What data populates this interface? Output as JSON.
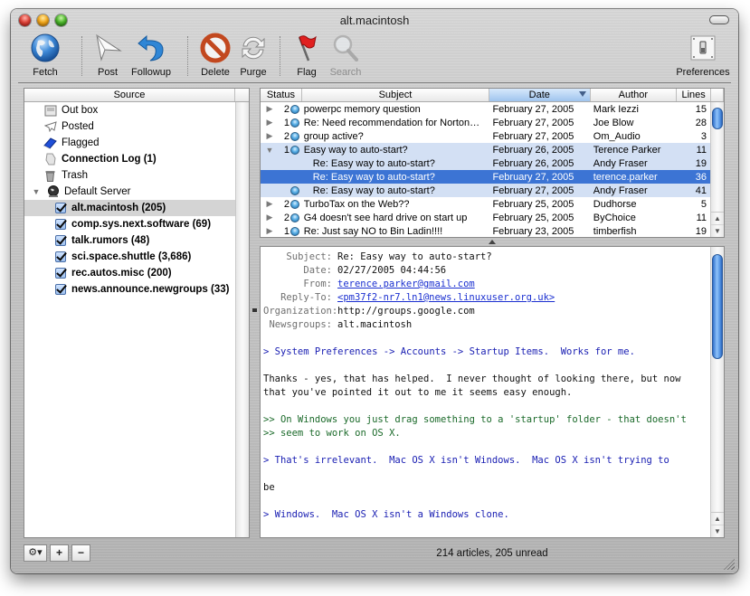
{
  "window": {
    "title": "alt.macintosh",
    "controls": [
      "close",
      "minimize",
      "zoom"
    ]
  },
  "toolbar": {
    "items": [
      {
        "id": "fetch",
        "label": "Fetch",
        "icon": "globe-icon",
        "enabled": true
      },
      {
        "id": "post",
        "label": "Post",
        "icon": "paper-plane-icon",
        "enabled": true
      },
      {
        "id": "followup",
        "label": "Followup",
        "icon": "reply-arrow-icon",
        "enabled": true
      },
      {
        "id": "delete",
        "label": "Delete",
        "icon": "no-entry-icon",
        "enabled": true
      },
      {
        "id": "purge",
        "label": "Purge",
        "icon": "refresh-arrows-icon",
        "enabled": true
      },
      {
        "id": "flag",
        "label": "Flag",
        "icon": "red-flag-icon",
        "enabled": true
      },
      {
        "id": "search",
        "label": "Search",
        "icon": "magnifier-icon",
        "enabled": false
      },
      {
        "id": "preferences",
        "label": "Preferences",
        "icon": "light-switch-icon",
        "enabled": true
      }
    ]
  },
  "source": {
    "header": "Source",
    "items": [
      {
        "label": "Out box",
        "icon": "outbox-icon",
        "bold": false,
        "level": 1
      },
      {
        "label": "Posted",
        "icon": "paper-plane-icon",
        "bold": false,
        "level": 1
      },
      {
        "label": "Flagged",
        "icon": "blue-book-icon",
        "bold": false,
        "level": 1
      },
      {
        "label": "Connection Log (1)",
        "icon": "log-document-icon",
        "bold": true,
        "level": 1
      },
      {
        "label": "Trash",
        "icon": "trash-icon",
        "bold": false,
        "level": 1
      },
      {
        "label": "Default Server",
        "icon": "server-globe-icon",
        "bold": false,
        "level": 0,
        "expanded": true
      }
    ],
    "groups": [
      {
        "label": "alt.macintosh (205)",
        "checked": true,
        "selected": true
      },
      {
        "label": "comp.sys.next.software (69)",
        "checked": true,
        "selected": false
      },
      {
        "label": "talk.rumors (48)",
        "checked": true,
        "selected": false
      },
      {
        "label": "sci.space.shuttle (3,686)",
        "checked": true,
        "selected": false
      },
      {
        "label": "rec.autos.misc (200)",
        "checked": true,
        "selected": false
      },
      {
        "label": "news.announce.newgroups (33)",
        "checked": true,
        "selected": false
      }
    ]
  },
  "articles": {
    "columns": [
      "Status",
      "Subject",
      "Date",
      "Author",
      "Lines"
    ],
    "sorted_column": "Date",
    "rows": [
      {
        "disclosure": "collapsed",
        "count": "2",
        "unread": true,
        "subject": "powerpc memory question",
        "date": "February 27, 2005",
        "author": "Mark Iezzi",
        "lines": "15",
        "state": "normal",
        "reply": false
      },
      {
        "disclosure": "collapsed",
        "count": "1",
        "unread": true,
        "subject": "Re: Need recommendation for Norton…",
        "date": "February 27, 2005",
        "author": "Joe Blow",
        "lines": "28",
        "state": "normal",
        "reply": false
      },
      {
        "disclosure": "collapsed",
        "count": "2",
        "unread": true,
        "subject": "group active?",
        "date": "February 27, 2005",
        "author": "Om_Audio",
        "lines": "3",
        "state": "normal",
        "reply": false
      },
      {
        "disclosure": "expanded",
        "count": "1",
        "unread": true,
        "subject": "Easy way to auto-start?",
        "date": "February 26, 2005",
        "author": "Terence Parker",
        "lines": "11",
        "state": "thread",
        "reply": false
      },
      {
        "disclosure": "",
        "count": "",
        "unread": false,
        "subject": "Re: Easy way to auto-start?",
        "date": "February 26, 2005",
        "author": "Andy Fraser",
        "lines": "19",
        "state": "thread",
        "reply": true
      },
      {
        "disclosure": "",
        "count": "",
        "unread": false,
        "subject": "Re: Easy way to auto-start?",
        "date": "February 27, 2005",
        "author": "terence.parker",
        "lines": "36",
        "state": "selected",
        "reply": true
      },
      {
        "disclosure": "",
        "count": "",
        "unread": true,
        "subject": "Re: Easy way to auto-start?",
        "date": "February 27, 2005",
        "author": "Andy Fraser",
        "lines": "41",
        "state": "thread",
        "reply": true
      },
      {
        "disclosure": "collapsed",
        "count": "2",
        "unread": true,
        "subject": "TurboTax on the Web??",
        "date": "February 25, 2005",
        "author": "Dudhorse",
        "lines": "5",
        "state": "normal",
        "reply": false
      },
      {
        "disclosure": "collapsed",
        "count": "2",
        "unread": true,
        "subject": "G4 doesn't see hard drive on start up",
        "date": "February 25, 2005",
        "author": "ByChoice",
        "lines": "11",
        "state": "normal",
        "reply": false
      },
      {
        "disclosure": "collapsed",
        "count": "1",
        "unread": true,
        "subject": "Re: Just say NO to Bin Ladin!!!!",
        "date": "February 23, 2005",
        "author": "timberfish",
        "lines": "19",
        "state": "normal",
        "reply": false
      }
    ]
  },
  "message": {
    "headers": [
      {
        "key": "Subject:",
        "value": "Re: Easy way to auto-start?",
        "link": false
      },
      {
        "key": "Date:",
        "value": "02/27/2005 04:44:56",
        "link": false
      },
      {
        "key": "From:",
        "value": "terence.parker@gmail.com",
        "link": true
      },
      {
        "key": "Reply-To:",
        "value": "<pm37f2-nr7.ln1@news.linuxuser.org.uk>",
        "link": true
      },
      {
        "key": "Organization:",
        "value": "http://groups.google.com",
        "link": false
      },
      {
        "key": "Newsgroups:",
        "value": "alt.macintosh",
        "link": false
      }
    ],
    "body": [
      {
        "text": "",
        "style": "gap"
      },
      {
        "text": "> System Preferences -> Accounts -> Startup Items.  Works for me.",
        "style": "q1"
      },
      {
        "text": "",
        "style": "gap"
      },
      {
        "text": "Thanks - yes, that has helped.  I never thought of looking there, but now",
        "style": "plain"
      },
      {
        "text": "that you've pointed it out to me it seems easy enough.",
        "style": "plain"
      },
      {
        "text": "",
        "style": "gap"
      },
      {
        "text": ">> On Windows you just drag something to a 'startup' folder - that doesn't",
        "style": "q2"
      },
      {
        "text": ">> seem to work on OS X.",
        "style": "q2"
      },
      {
        "text": "",
        "style": "gap"
      },
      {
        "text": "> That's irrelevant.  Mac OS X isn't Windows.  Mac OS X isn't trying to",
        "style": "q1"
      },
      {
        "text": "",
        "style": "gap"
      },
      {
        "text": "be",
        "style": "plain"
      },
      {
        "text": "",
        "style": "gap"
      },
      {
        "text": "> Windows.  Mac OS X isn't a Windows clone.",
        "style": "q1"
      }
    ]
  },
  "bottom": {
    "action_menu": "gear-icon",
    "add_label": "+",
    "remove_label": "−",
    "status": "214 articles, 205 unread"
  },
  "colors": {
    "selection": "#3c74d4",
    "thread_highlight": "#d3e0f4",
    "quote_level1": "#1b20b3",
    "quote_level2": "#1b6a2a",
    "link": "#1a2fd0"
  }
}
